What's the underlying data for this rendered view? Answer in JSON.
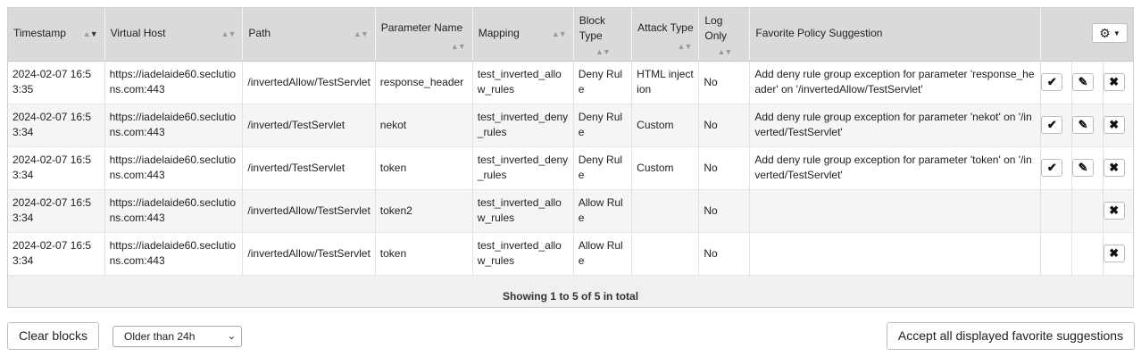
{
  "columns": {
    "timestamp": "Timestamp",
    "virtual_host": "Virtual Host",
    "path": "Path",
    "parameter_name": "Parameter Name",
    "mapping": "Mapping",
    "block_type": "Block Type",
    "attack_type": "Attack Type",
    "log_only": "Log Only",
    "favorite": "Favorite Policy Suggestion"
  },
  "rows": [
    {
      "timestamp": "2024-02-07 16:53:35",
      "virtual_host": "https://iadelaide60.seclutions.com:443",
      "path": "/invertedAllow/TestServlet",
      "parameter_name": "response_header",
      "mapping": "test_inverted_allow_rules",
      "block_type": "Deny Rule",
      "attack_type": "HTML injection",
      "log_only": "No",
      "suggestion": "Add deny rule group exception for parameter 'response_header' on '/invertedAllow/TestServlet'",
      "has_accept": true,
      "has_edit": true
    },
    {
      "timestamp": "2024-02-07 16:53:34",
      "virtual_host": "https://iadelaide60.seclutions.com:443",
      "path": "/inverted/TestServlet",
      "parameter_name": "nekot",
      "mapping": "test_inverted_deny_rules",
      "block_type": "Deny Rule",
      "attack_type": "Custom",
      "log_only": "No",
      "suggestion": "Add deny rule group exception for parameter 'nekot' on '/inverted/TestServlet'",
      "has_accept": true,
      "has_edit": true
    },
    {
      "timestamp": "2024-02-07 16:53:34",
      "virtual_host": "https://iadelaide60.seclutions.com:443",
      "path": "/inverted/TestServlet",
      "parameter_name": "token",
      "mapping": "test_inverted_deny_rules",
      "block_type": "Deny Rule",
      "attack_type": "Custom",
      "log_only": "No",
      "suggestion": "Add deny rule group exception for parameter 'token' on '/inverted/TestServlet'",
      "has_accept": true,
      "has_edit": true
    },
    {
      "timestamp": "2024-02-07 16:53:34",
      "virtual_host": "https://iadelaide60.seclutions.com:443",
      "path": "/invertedAllow/TestServlet",
      "parameter_name": "token2",
      "mapping": "test_inverted_allow_rules",
      "block_type": "Allow Rule",
      "attack_type": "",
      "log_only": "No",
      "suggestion": "",
      "has_accept": false,
      "has_edit": false
    },
    {
      "timestamp": "2024-02-07 16:53:34",
      "virtual_host": "https://iadelaide60.seclutions.com:443",
      "path": "/invertedAllow/TestServlet",
      "parameter_name": "token",
      "mapping": "test_inverted_allow_rules",
      "block_type": "Allow Rule",
      "attack_type": "",
      "log_only": "No",
      "suggestion": "",
      "has_accept": false,
      "has_edit": false
    }
  ],
  "footer": {
    "prefix": "Showing",
    "from": "1",
    "to_word": "to",
    "to": "5",
    "of_word": "of",
    "total": "5",
    "suffix": "in total"
  },
  "controls": {
    "clear_blocks": "Clear blocks",
    "age_filter": "Older than 24h",
    "accept_all": "Accept all displayed favorite suggestions"
  },
  "icons": {
    "accept": "check-icon",
    "edit": "pencil-icon",
    "delete": "close-icon",
    "settings": "gear-icon",
    "sort": "sort-arrows-icon"
  }
}
